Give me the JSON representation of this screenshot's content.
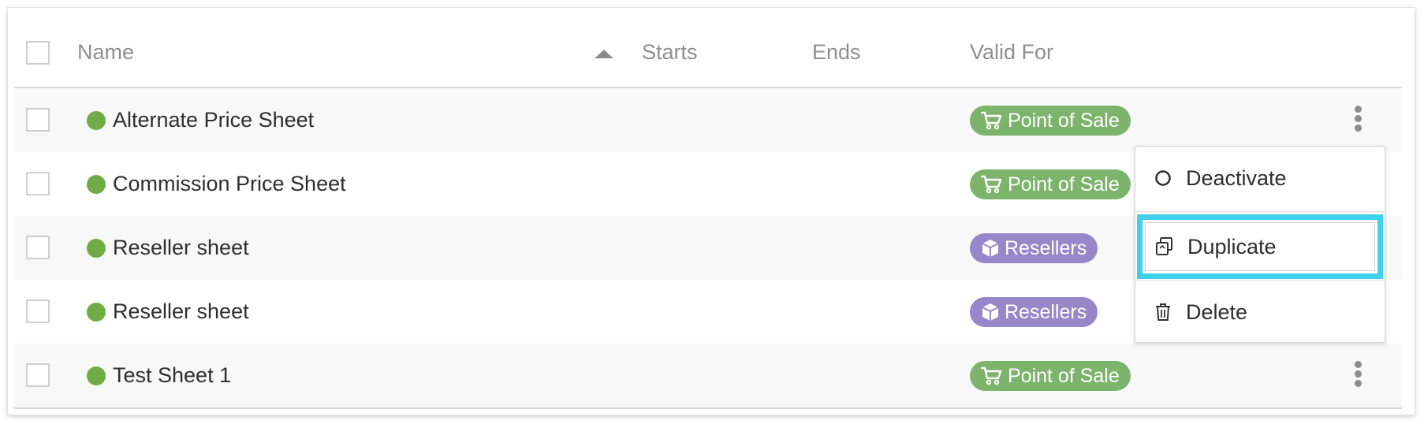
{
  "table": {
    "columns": {
      "name": "Name",
      "starts": "Starts",
      "ends": "Ends",
      "valid_for": "Valid For"
    },
    "sort": {
      "column": "name",
      "direction": "ascending"
    },
    "rows": [
      {
        "name": "Alternate Price Sheet",
        "status": "active",
        "valid_for": "Point of Sale",
        "badge_type": "point-of-sale"
      },
      {
        "name": "Commission Price Sheet",
        "status": "active",
        "valid_for": "Point of Sale",
        "badge_type": "point-of-sale"
      },
      {
        "name": "Reseller sheet",
        "status": "active",
        "valid_for": "Resellers",
        "badge_type": "resellers"
      },
      {
        "name": "Reseller sheet",
        "status": "active",
        "valid_for": "Resellers",
        "badge_type": "resellers"
      },
      {
        "name": "Test Sheet 1",
        "status": "active",
        "valid_for": "Point of Sale",
        "badge_type": "point-of-sale"
      }
    ]
  },
  "context_menu": {
    "items": [
      {
        "label": "Deactivate",
        "icon": "circle-outline-icon"
      },
      {
        "label": "Duplicate",
        "icon": "duplicate-icon",
        "highlighted": true
      },
      {
        "label": "Delete",
        "icon": "trash-icon"
      }
    ]
  },
  "colors": {
    "status_active": "#6fac46",
    "badge_point_of_sale": "#7db46c",
    "badge_resellers": "#9787c8",
    "highlight": "#3fd1ea"
  }
}
